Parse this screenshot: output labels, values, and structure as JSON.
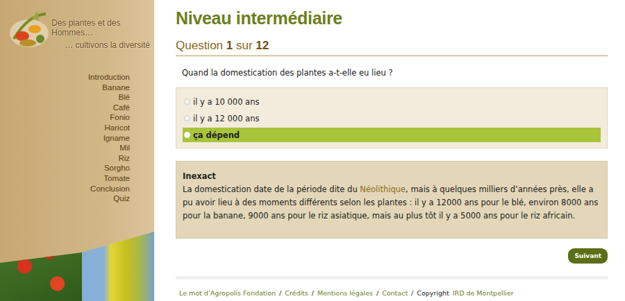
{
  "logo": {
    "line1": "Des plantes et des Hommes…",
    "line2": "… cultivons la diversité"
  },
  "nav": [
    {
      "label": "Introduction"
    },
    {
      "label": "Banane"
    },
    {
      "label": "Blé"
    },
    {
      "label": "Café"
    },
    {
      "label": "Fonio"
    },
    {
      "label": "Haricot"
    },
    {
      "label": "Igname"
    },
    {
      "label": "Mil"
    },
    {
      "label": "Riz"
    },
    {
      "label": "Sorgho"
    },
    {
      "label": "Tomate"
    },
    {
      "label": "Conclusion"
    },
    {
      "label": "Quiz"
    }
  ],
  "title": "Niveau intermédiaire",
  "question_counter": {
    "prefix": "Question",
    "current": "1",
    "middle": "sur",
    "total": "12"
  },
  "question": "Quand la domestication des plantes a-t-elle eu lieu ?",
  "options": [
    {
      "label": "il y a 10 000 ans",
      "selected": false
    },
    {
      "label": "il y a 12 000 ans",
      "selected": false
    },
    {
      "label": "ça dépend",
      "selected": true
    }
  ],
  "feedback": {
    "title": "Inexact",
    "before": "La domestication date de la période dite du ",
    "link": "Néolithique",
    "after": ", mais à quelques milliers d’années près, elle a pu avoir lieu à des moments différents selon les plantes : il y a 12000 ans pour le blé, environ 8000 ans pour la banane, 9000 ans pour le riz asiatique, mais au plus tôt il y a 5000 ans pour le riz africain."
  },
  "next_button": "Suivant",
  "footer": {
    "links": [
      "Le mot d’Agropolis Fondation",
      "Crédits",
      "Mentions légales",
      "Contact"
    ],
    "separator": "/",
    "copyright_prefix": "Copyright",
    "copyright_link": "IRD de Montpellier"
  }
}
